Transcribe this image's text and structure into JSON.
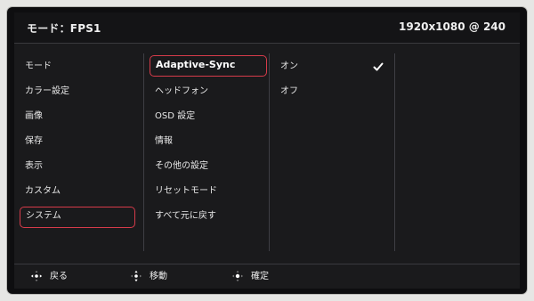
{
  "header": {
    "mode": "モード：FPS1",
    "resolution": "1920x1080 @ 240"
  },
  "main_menu": [
    {
      "label": "モード",
      "selected": false
    },
    {
      "label": "カラー設定",
      "selected": false
    },
    {
      "label": "画像",
      "selected": false
    },
    {
      "label": "保存",
      "selected": false
    },
    {
      "label": "表示",
      "selected": false
    },
    {
      "label": "カスタム",
      "selected": false
    },
    {
      "label": "システム",
      "selected": true
    }
  ],
  "sub_menu": [
    {
      "label": "Adaptive-Sync",
      "selected": true
    },
    {
      "label": "ヘッドフォン",
      "selected": false
    },
    {
      "label": "OSD 設定",
      "selected": false
    },
    {
      "label": "情報",
      "selected": false
    },
    {
      "label": "その他の設定",
      "selected": false
    },
    {
      "label": "リセットモード",
      "selected": false
    },
    {
      "label": "すべて元に戻す",
      "selected": false
    }
  ],
  "options": [
    {
      "label": "オン",
      "checked": true,
      "check_icon": "checkmark-icon"
    },
    {
      "label": "オフ",
      "checked": false
    }
  ],
  "footer": {
    "back": {
      "label": "戻る",
      "icon": "dpad-horizontal-icon"
    },
    "move": {
      "label": "移動",
      "icon": "dpad-vertical-icon"
    },
    "confirm": {
      "label": "確定",
      "icon": "dpad-center-icon"
    }
  },
  "colors": {
    "highlight": "#d63b4a",
    "background": "#1a1a1c",
    "text": "#f0f0f0"
  }
}
